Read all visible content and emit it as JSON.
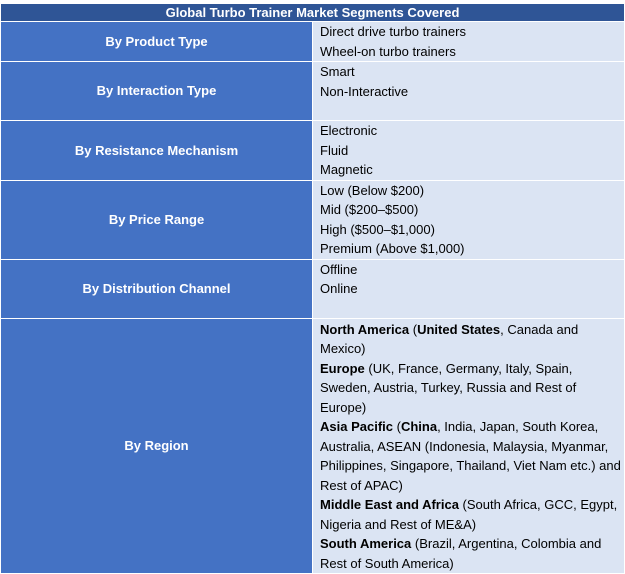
{
  "title": "Global Turbo Trainer Market Segments Covered",
  "segments": {
    "product": {
      "label": "By Product Type",
      "items": [
        "Direct drive turbo trainers",
        "Wheel-on turbo trainers"
      ]
    },
    "interaction": {
      "label": "By Interaction Type",
      "items": [
        "Smart",
        "Non-Interactive"
      ]
    },
    "resistance": {
      "label": "By Resistance Mechanism",
      "items": [
        "Electronic",
        "Fluid",
        "Magnetic"
      ]
    },
    "price": {
      "label": "By Price Range",
      "items": [
        "Low (Below $200)",
        "Mid ($200–$500)",
        "High ($500–$1,000)",
        "Premium (Above $1,000)"
      ]
    },
    "distribution": {
      "label": "By Distribution Channel",
      "items": [
        "Offline",
        "Online"
      ]
    },
    "region": {
      "label": "By Region",
      "items": [
        {
          "name": "North America",
          "open": " (",
          "lead": "United States",
          "rest": ", Canada and Mexico)"
        },
        {
          "name": "Europe",
          "open": " (",
          "lead": "",
          "rest": "UK, France, Germany, Italy, Spain, Sweden, Austria, Turkey, Russia and Rest of Europe)"
        },
        {
          "name": "Asia Pacific",
          "open": " (",
          "lead": "China",
          "rest": ", India, Japan, South Korea, Australia, ASEAN (Indonesia, Malaysia, Myanmar, Philippines, Singapore, Thailand, Viet Nam etc.) and Rest of APAC)"
        },
        {
          "name": "Middle East and Africa",
          "open": " (",
          "lead": "",
          "rest": "South Africa, GCC, Egypt, Nigeria and Rest of ME&A)"
        },
        {
          "name": "South America",
          "open": " (",
          "lead": "",
          "rest": "Brazil, Argentina, Colombia and Rest of South America)"
        }
      ]
    }
  }
}
